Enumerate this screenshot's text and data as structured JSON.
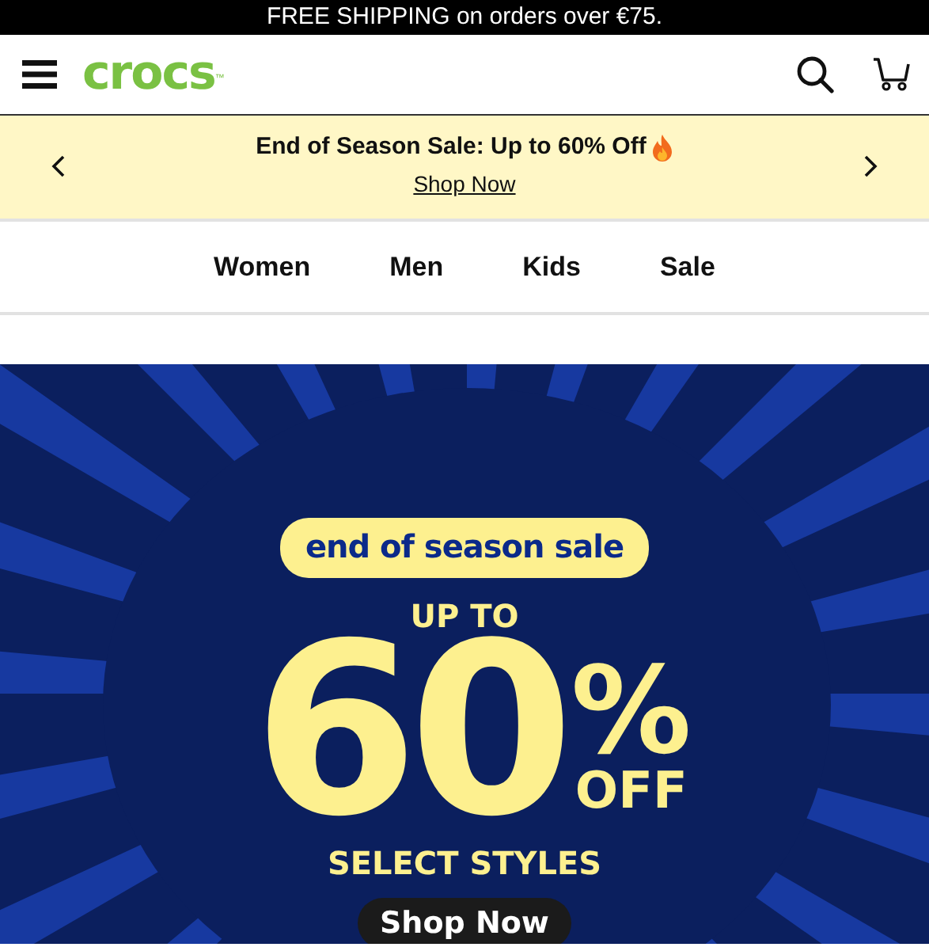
{
  "announcement": "FREE SHIPPING on orders over €75.",
  "header": {
    "logo": "crocs",
    "logo_mark": "™"
  },
  "promo": {
    "title": "End of Season Sale: Up to 60% Off",
    "link": "Shop Now"
  },
  "nav": [
    {
      "label": "Women"
    },
    {
      "label": "Men"
    },
    {
      "label": "Kids"
    },
    {
      "label": "Sale"
    }
  ],
  "hero": {
    "badge": "end of season sale",
    "line_1": "UP TO",
    "big": "60",
    "percent": "%",
    "off": "OFF",
    "line_2": "SELECT STYLES",
    "button": "Shop Now"
  }
}
